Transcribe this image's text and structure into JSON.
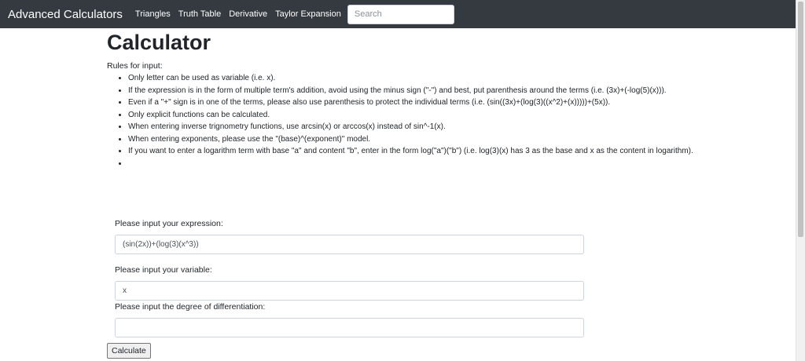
{
  "nav": {
    "brand": "Advanced Calculators",
    "links": [
      "Triangles",
      "Truth Table",
      "Derivative",
      "Taylor Expansion"
    ],
    "search_placeholder": "Search"
  },
  "page": {
    "title": "Calculator",
    "rules_title": "Rules for input:",
    "rules": [
      "Only letter can be used as variable (i.e. x).",
      "If the expression is in the form of multiple term's addition, avoid using the minus sign (\"-\") and best, put parenthesis around the terms (i.e. (3x)+(-log(5)(x))).",
      "Even if a \"+\" sign is in one of the terms, please also use parenthesis to protect the individual terms (i.e. (sin((3x)+(log(3)((x^2)+(x)))))+(5x)).",
      "Only explicit functions can be calculated.",
      "When entering inverse trignometry functions, use arcsin(x) or arccos(x) instead of sin^-1(x).",
      "When entering exponents, please use the \"(base)^(exponent)\" model.",
      "If you want to enter a logarithm term with base \"a\" and content \"b\", enter in the form log(\"a\")(\"b\") (i.e. log(3)(x) has 3 as the base and x as the content in logarithm).",
      ""
    ]
  },
  "form": {
    "expression_label": "Please input your expression:",
    "expression_value": "(sin(2x))+(log(3)(x^3))",
    "variable_label": "Please input your variable:",
    "variable_value": "x",
    "degree_label": "Please input the degree of differentiation:",
    "degree_value": "",
    "submit_label": "Calculate"
  }
}
